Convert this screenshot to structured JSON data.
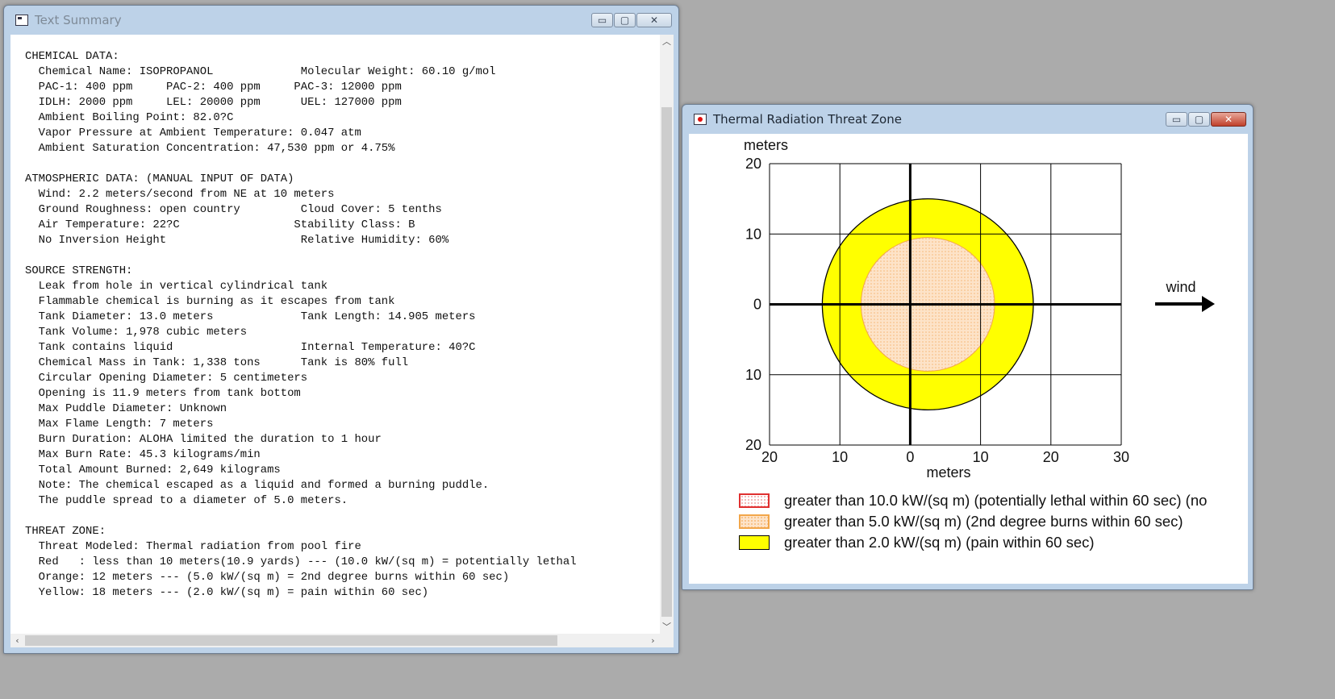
{
  "text_window": {
    "title": "Text Summary",
    "controls": {
      "minimize": "▭",
      "maximize": "▢",
      "close": "✕"
    },
    "lines": [
      "CHEMICAL DATA:",
      "  Chemical Name: ISOPROPANOL             Molecular Weight: 60.10 g/mol",
      "  PAC-1: 400 ppm     PAC-2: 400 ppm     PAC-3: 12000 ppm",
      "  IDLH: 2000 ppm     LEL: 20000 ppm      UEL: 127000 ppm",
      "  Ambient Boiling Point: 82.0?C",
      "  Vapor Pressure at Ambient Temperature: 0.047 atm",
      "  Ambient Saturation Concentration: 47,530 ppm or 4.75%",
      "",
      "ATMOSPHERIC DATA: (MANUAL INPUT OF DATA)",
      "  Wind: 2.2 meters/second from NE at 10 meters",
      "  Ground Roughness: open country         Cloud Cover: 5 tenths",
      "  Air Temperature: 22?C                 Stability Class: B",
      "  No Inversion Height                    Relative Humidity: 60%",
      "",
      "SOURCE STRENGTH:",
      "  Leak from hole in vertical cylindrical tank",
      "  Flammable chemical is burning as it escapes from tank",
      "  Tank Diameter: 13.0 meters             Tank Length: 14.905 meters",
      "  Tank Volume: 1,978 cubic meters",
      "  Tank contains liquid                   Internal Temperature: 40?C",
      "  Chemical Mass in Tank: 1,338 tons      Tank is 80% full",
      "  Circular Opening Diameter: 5 centimeters",
      "  Opening is 11.9 meters from tank bottom",
      "  Max Puddle Diameter: Unknown",
      "  Max Flame Length: 7 meters",
      "  Burn Duration: ALOHA limited the duration to 1 hour",
      "  Max Burn Rate: 45.3 kilograms/min",
      "  Total Amount Burned: 2,649 kilograms",
      "  Note: The chemical escaped as a liquid and formed a burning puddle.",
      "  The puddle spread to a diameter of 5.0 meters.",
      "",
      "THREAT ZONE:",
      "  Threat Modeled: Thermal radiation from pool fire",
      "  Red   : less than 10 meters(10.9 yards) --- (10.0 kW/(sq m) = potentially lethal",
      "  Orange: 12 meters --- (5.0 kW/(sq m) = 2nd degree burns within 60 sec)",
      "  Yellow: 18 meters --- (2.0 kW/(sq m) = pain within 60 sec)"
    ]
  },
  "threat_window": {
    "title": "Thermal Radiation Threat Zone",
    "controls": {
      "minimize": "▭",
      "maximize": "▢",
      "close": "✕"
    },
    "legend": [
      {
        "key": "red",
        "label": "greater than 10.0 kW/(sq m) (potentially lethal within 60 sec) (no"
      },
      {
        "key": "orange",
        "label": "greater than 5.0 kW/(sq m) (2nd degree burns within 60 sec)"
      },
      {
        "key": "yellow",
        "label": "greater than 2.0 kW/(sq m) (pain within 60 sec)"
      }
    ],
    "wind_label": "wind",
    "colors": {
      "yellow": "#ffff00",
      "orange_fill": "#fde3c8",
      "orange_edge": "#f2a64a",
      "red_edge": "#e03030"
    }
  },
  "chart_data": {
    "type": "scatter",
    "title": "",
    "xlabel": "meters",
    "ylabel": "meters",
    "xlim": [
      -20,
      30
    ],
    "ylim": [
      -20,
      20
    ],
    "x_ticks": [
      -20,
      -10,
      0,
      10,
      20,
      30
    ],
    "y_ticks": [
      20,
      10,
      0,
      -10,
      -20
    ],
    "x_tick_labels": [
      "20",
      "10",
      "0",
      "10",
      "20",
      "30"
    ],
    "y_tick_labels": [
      "20",
      "10",
      "0",
      "10",
      "20"
    ],
    "grid": true,
    "zones": [
      {
        "name": "yellow",
        "center": [
          2.5,
          0
        ],
        "radius": 15,
        "threshold": "2.0 kW/(sq m)"
      },
      {
        "name": "orange",
        "center": [
          2.5,
          0
        ],
        "radius": 9.5,
        "threshold": "5.0 kW/(sq m)"
      }
    ]
  }
}
